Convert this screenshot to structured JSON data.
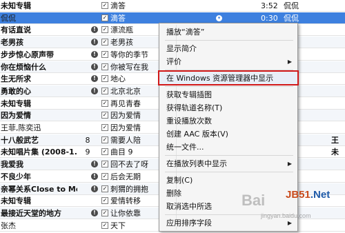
{
  "rows": [
    {
      "album": "未知专辑",
      "title": "滴答",
      "time": "3:52",
      "artist": "侃侃",
      "check": true,
      "warn": false,
      "num": "",
      "right": ""
    },
    {
      "album": "侃侃",
      "album_plain": true,
      "title": "滴答",
      "time": "0:30",
      "artist": "侃侃",
      "check": true,
      "warn": false,
      "num": "",
      "right": "",
      "selected": true
    },
    {
      "album": "有话直说",
      "title": "漂流瓶",
      "time": "",
      "artist": "",
      "check": true,
      "warn": true,
      "num": "",
      "right": ""
    },
    {
      "album": "老男孩",
      "title": "老男孩",
      "time": "",
      "artist": "",
      "check": true,
      "warn": true,
      "num": "",
      "right": ""
    },
    {
      "album": "步步惊心原声带",
      "title": "等你的季节",
      "time": "",
      "artist": "",
      "check": true,
      "warn": true,
      "num": "",
      "right": ""
    },
    {
      "album": "你在烦恼什么",
      "title": "你被写在我",
      "time": "",
      "artist": "",
      "check": true,
      "warn": true,
      "num": "",
      "right": ""
    },
    {
      "album": "生无所求",
      "title": "地心",
      "time": "",
      "artist": "",
      "check": true,
      "warn": true,
      "num": "",
      "right": ""
    },
    {
      "album": "勇敢的心",
      "title": "北京北京",
      "time": "",
      "artist": "",
      "check": true,
      "warn": true,
      "num": "",
      "right": ""
    },
    {
      "album": "未知专辑",
      "title": "再见青春",
      "time": "",
      "artist": "",
      "check": true,
      "warn": false,
      "num": "",
      "right": ""
    },
    {
      "album": "因为爱情",
      "title": "因为爱情",
      "time": "",
      "artist": "",
      "check": true,
      "warn": false,
      "num": "",
      "right": ""
    },
    {
      "album": "王菲,陈奕迅",
      "album_plain": true,
      "title": "因为爱情",
      "time": "",
      "artist": "",
      "check": true,
      "warn": false,
      "num": "",
      "right": ""
    },
    {
      "album": "十八般武艺",
      "title": "需要人陪",
      "time": "",
      "artist": "",
      "check": true,
      "warn": false,
      "num": "8",
      "right": "王"
    },
    {
      "album": "未知唱片集 (2008-1...",
      "title": "曲目 9",
      "time": "",
      "artist": "",
      "check": true,
      "warn": false,
      "num": "9",
      "right": "未"
    },
    {
      "album": "我爱我",
      "title": "回不去了呀",
      "time": "",
      "artist": "",
      "check": true,
      "warn": true,
      "num": "",
      "right": ""
    },
    {
      "album": "不良少年",
      "title": "后会无期",
      "time": "",
      "artist": "",
      "check": true,
      "warn": true,
      "num": "",
      "right": ""
    },
    {
      "album": "亲幂关系Close to Me",
      "title": "刺猬的拥抱",
      "time": "",
      "artist": "",
      "check": true,
      "warn": true,
      "num": "",
      "right": ""
    },
    {
      "album": "未知专辑",
      "title": "爱情转移",
      "time": "",
      "artist": "",
      "check": true,
      "warn": false,
      "num": "",
      "right": ""
    },
    {
      "album": "最接近天堂的地方",
      "title": "让你依靠",
      "time": "",
      "artist": "",
      "check": true,
      "warn": true,
      "num": "",
      "right": ""
    },
    {
      "album": "张杰",
      "album_plain": true,
      "title": "天下",
      "time": "",
      "artist": "",
      "check": true,
      "warn": false,
      "num": "",
      "right": ""
    }
  ],
  "menu": {
    "items": [
      {
        "label": "播放“滴答”",
        "sep_after": true
      },
      {
        "label": "显示简介"
      },
      {
        "label": "评价",
        "submenu": true,
        "sep_after": true
      },
      {
        "label": "在 Windows 资源管理器中显示",
        "highlight": true,
        "sep_after": true
      },
      {
        "label": "获取专辑插图"
      },
      {
        "label": "获得轨道名称(T)"
      },
      {
        "label": "重设播放次数"
      },
      {
        "label": "创建 AAC 版本(V)"
      },
      {
        "label": "统一文件...",
        "sep_after": true
      },
      {
        "label": "在播放列表中显示",
        "submenu": true,
        "sep_after": true
      },
      {
        "label": "复制(C)"
      },
      {
        "label": "删除"
      },
      {
        "label": "取消选中所选",
        "sep_after": true
      },
      {
        "label": "应用排序字段",
        "submenu": true
      }
    ]
  },
  "watermark": {
    "baidu": "Bai",
    "jb": "JB51",
    "jb_suffix": ".Net",
    "sub": "jingyan.baidu.com"
  },
  "colors": {
    "selection": "#3d80df",
    "highlight_border": "#d11717"
  }
}
